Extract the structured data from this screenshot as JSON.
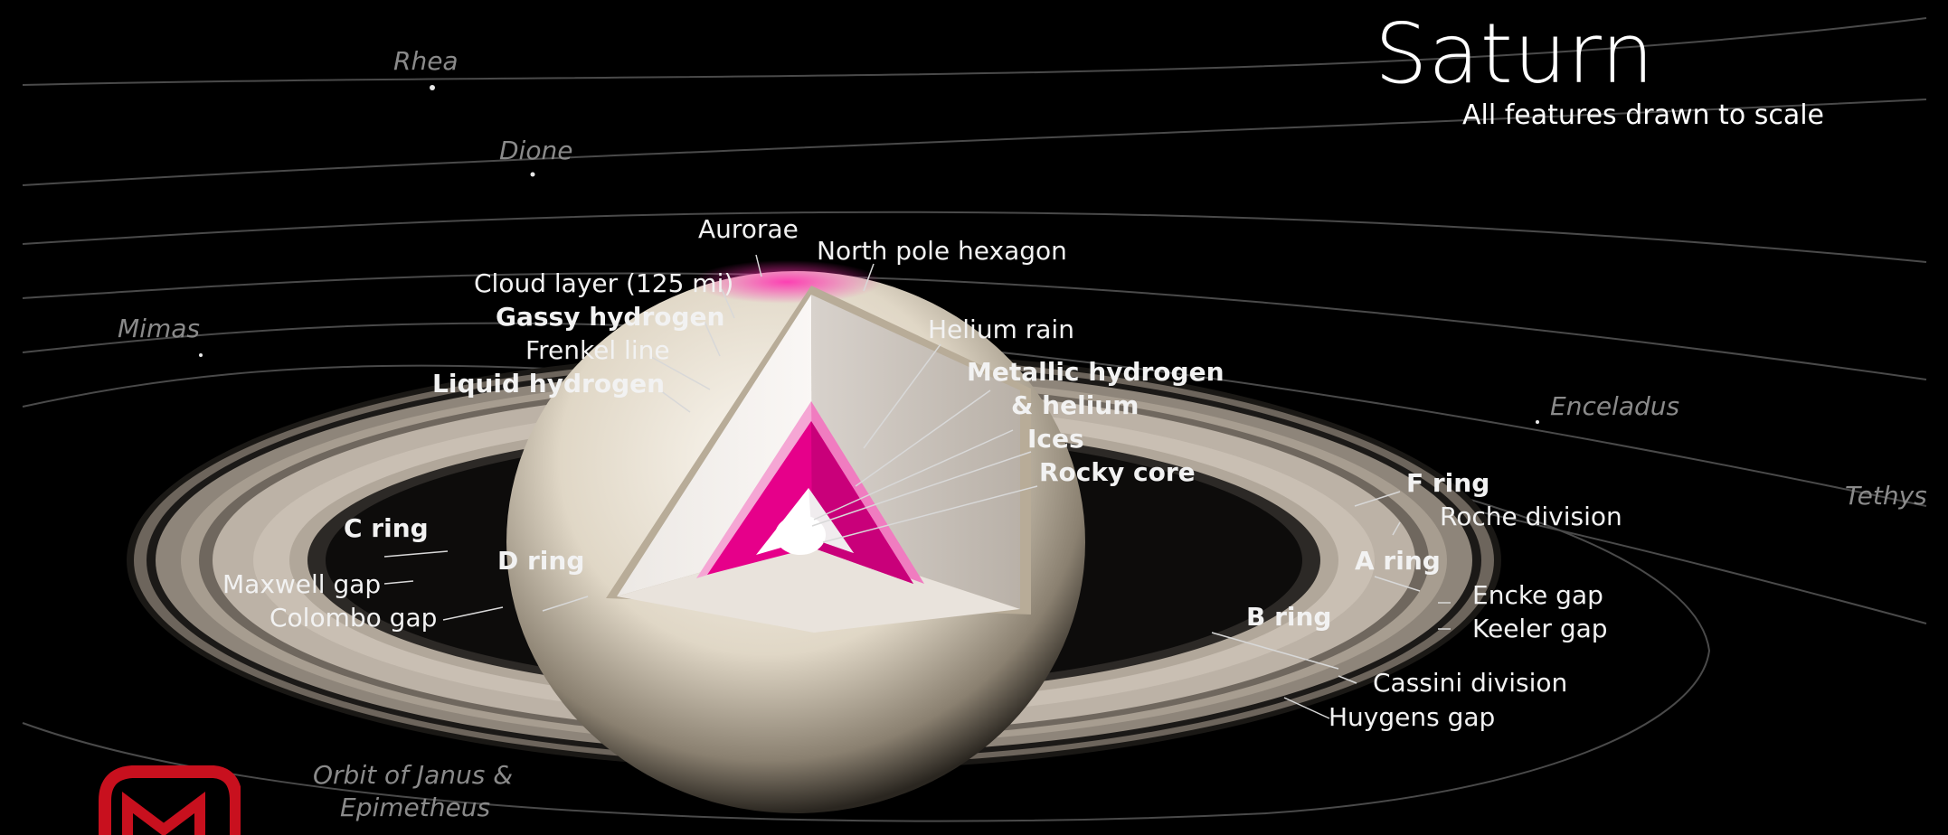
{
  "title": "Saturn",
  "subtitle": "All features drawn to scale",
  "moons": {
    "rhea": "Rhea",
    "dione": "Dione",
    "mimas": "Mimas",
    "enceladus": "Enceladus",
    "tethys": "Tethys",
    "janus_line1": "Orbit of Janus &",
    "janus_line2": "Epimetheus"
  },
  "interior": {
    "aurorae": "Aurorae",
    "north_pole_hexagon": "North pole hexagon",
    "cloud_layer": "Cloud layer (125 mi)",
    "gassy_hydrogen": "Gassy hydrogen",
    "frenkel_line": "Frenkel line",
    "liquid_hydrogen": "Liquid hydrogen",
    "helium_rain": "Helium rain",
    "metallic_hydrogen_line1": "Metallic hydrogen",
    "metallic_hydrogen_line2": "& helium",
    "ices": "Ices",
    "rocky_core": "Rocky core"
  },
  "rings": {
    "c_ring": "C ring",
    "d_ring": "D ring",
    "maxwell_gap": "Maxwell gap",
    "colombo_gap": "Colombo gap",
    "f_ring": "F ring",
    "roche_division": "Roche division",
    "a_ring": "A ring",
    "encke_gap": "Encke gap",
    "keeler_gap": "Keeler gap",
    "b_ring": "B ring",
    "cassini_division": "Cassini division",
    "huygens_gap": "Huygens gap"
  },
  "colors": {
    "background": "#000000",
    "label": "#f2f2f2",
    "moon_label": "#8a8a8a",
    "core_magenta": "#e6008a",
    "logo_red": "#c8101e"
  },
  "icons": {
    "logo": "channel-logo-icon"
  }
}
